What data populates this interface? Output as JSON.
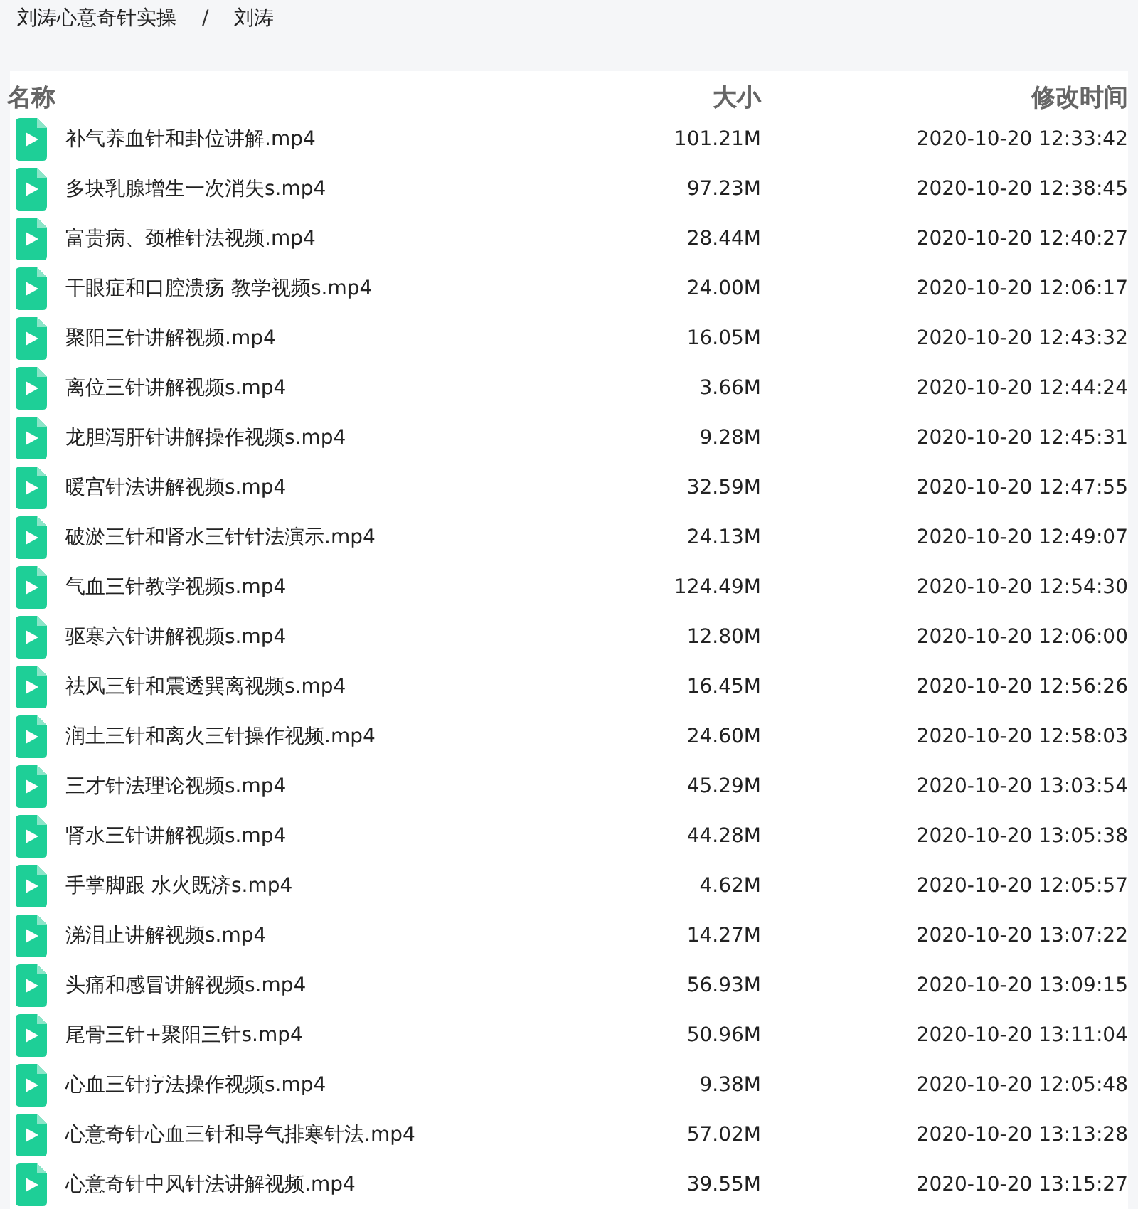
{
  "breadcrumb": [
    {
      "label": "刘涛心意奇针实操"
    },
    {
      "label": "刘涛"
    }
  ],
  "breadcrumb_separator": "/",
  "table": {
    "columns": [
      "名称",
      "大小",
      "修改时间"
    ],
    "rows": [
      {
        "name": "补气养血针和卦位讲解.mp4",
        "size": "101.21M",
        "modified": "2020-10-20 12:33:42"
      },
      {
        "name": "多块乳腺增生一次消失s.mp4",
        "size": "97.23M",
        "modified": "2020-10-20 12:38:45"
      },
      {
        "name": "富贵病、颈椎针法视频.mp4",
        "size": "28.44M",
        "modified": "2020-10-20 12:40:27"
      },
      {
        "name": "干眼症和口腔溃疡 教学视频s.mp4",
        "size": "24.00M",
        "modified": "2020-10-20 12:06:17"
      },
      {
        "name": "聚阳三针讲解视频.mp4",
        "size": "16.05M",
        "modified": "2020-10-20 12:43:32"
      },
      {
        "name": "离位三针讲解视频s.mp4",
        "size": "3.66M",
        "modified": "2020-10-20 12:44:24"
      },
      {
        "name": "龙胆泻肝针讲解操作视频s.mp4",
        "size": "9.28M",
        "modified": "2020-10-20 12:45:31"
      },
      {
        "name": "暖宫针法讲解视频s.mp4",
        "size": "32.59M",
        "modified": "2020-10-20 12:47:55"
      },
      {
        "name": "破淤三针和肾水三针针法演示.mp4",
        "size": "24.13M",
        "modified": "2020-10-20 12:49:07"
      },
      {
        "name": "气血三针教学视频s.mp4",
        "size": "124.49M",
        "modified": "2020-10-20 12:54:30"
      },
      {
        "name": "驱寒六针讲解视频s.mp4",
        "size": "12.80M",
        "modified": "2020-10-20 12:06:00"
      },
      {
        "name": "祛风三针和震透巽离视频s.mp4",
        "size": "16.45M",
        "modified": "2020-10-20 12:56:26"
      },
      {
        "name": "润土三针和离火三针操作视频.mp4",
        "size": "24.60M",
        "modified": "2020-10-20 12:58:03"
      },
      {
        "name": "三才针法理论视频s.mp4",
        "size": "45.29M",
        "modified": "2020-10-20 13:03:54"
      },
      {
        "name": "肾水三针讲解视频s.mp4",
        "size": "44.28M",
        "modified": "2020-10-20 13:05:38"
      },
      {
        "name": "手掌脚跟 水火既济s.mp4",
        "size": "4.62M",
        "modified": "2020-10-20 12:05:57"
      },
      {
        "name": "涕泪止讲解视频s.mp4",
        "size": "14.27M",
        "modified": "2020-10-20 13:07:22"
      },
      {
        "name": "头痛和感冒讲解视频s.mp4",
        "size": "56.93M",
        "modified": "2020-10-20 13:09:15"
      },
      {
        "name": "尾骨三针+聚阳三针s.mp4",
        "size": "50.96M",
        "modified": "2020-10-20 13:11:04"
      },
      {
        "name": "心血三针疗法操作视频s.mp4",
        "size": "9.38M",
        "modified": "2020-10-20 12:05:48"
      },
      {
        "name": "心意奇针心血三针和导气排寒针法.mp4",
        "size": "57.02M",
        "modified": "2020-10-20 13:13:28"
      },
      {
        "name": "心意奇针中风针法讲解视频.mp4",
        "size": "39.55M",
        "modified": "2020-10-20 13:15:27"
      }
    ]
  }
}
